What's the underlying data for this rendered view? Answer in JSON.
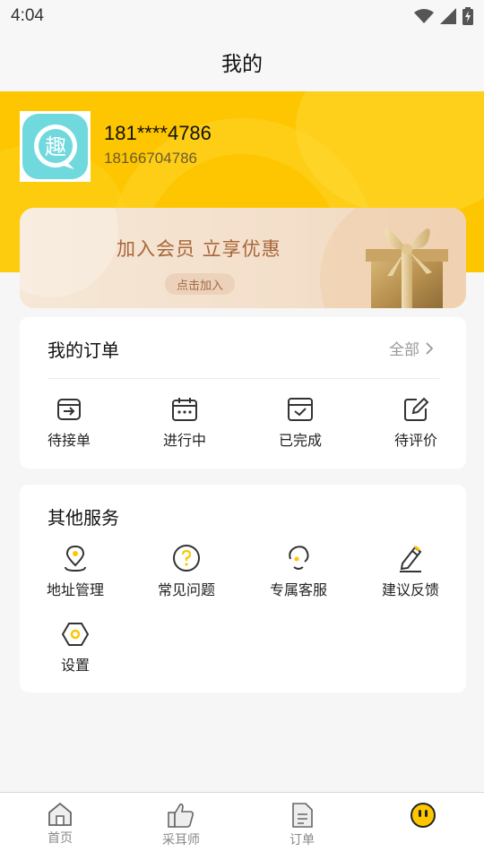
{
  "status_bar": {
    "time": "4:04",
    "icons": [
      "wifi-icon",
      "signal-icon",
      "battery-charging-icon"
    ]
  },
  "header": {
    "title": "我的"
  },
  "profile": {
    "name": "181****4786",
    "phone": "18166704786",
    "avatar_char": "趣"
  },
  "vip": {
    "title": "加入会员 立享优惠",
    "button": "点击加入"
  },
  "orders": {
    "title": "我的订单",
    "see_all": "全部",
    "items": [
      {
        "label": "待接单",
        "icon": "inbox-arrow-icon"
      },
      {
        "label": "进行中",
        "icon": "calendar-icon"
      },
      {
        "label": "已完成",
        "icon": "check-calendar-icon"
      },
      {
        "label": "待评价",
        "icon": "edit-icon"
      }
    ]
  },
  "services": {
    "title": "其他服务",
    "items": [
      {
        "label": "地址管理",
        "icon": "location-pin-icon"
      },
      {
        "label": "常见问题",
        "icon": "question-icon"
      },
      {
        "label": "专属客服",
        "icon": "headset-icon"
      },
      {
        "label": "建议反馈",
        "icon": "pencil-icon"
      },
      {
        "label": "设置",
        "icon": "settings-hexagon-icon"
      }
    ]
  },
  "bottom_nav": {
    "items": [
      {
        "label": "首页",
        "icon": "home-icon"
      },
      {
        "label": "采耳师",
        "icon": "thumbs-up-icon"
      },
      {
        "label": "订单",
        "icon": "document-icon"
      },
      {
        "label": "",
        "icon": "profile-face-icon"
      }
    ]
  },
  "colors": {
    "accent": "#fdc600",
    "vip_text": "#a7663a",
    "avatar_bg": "#6fd9de"
  }
}
